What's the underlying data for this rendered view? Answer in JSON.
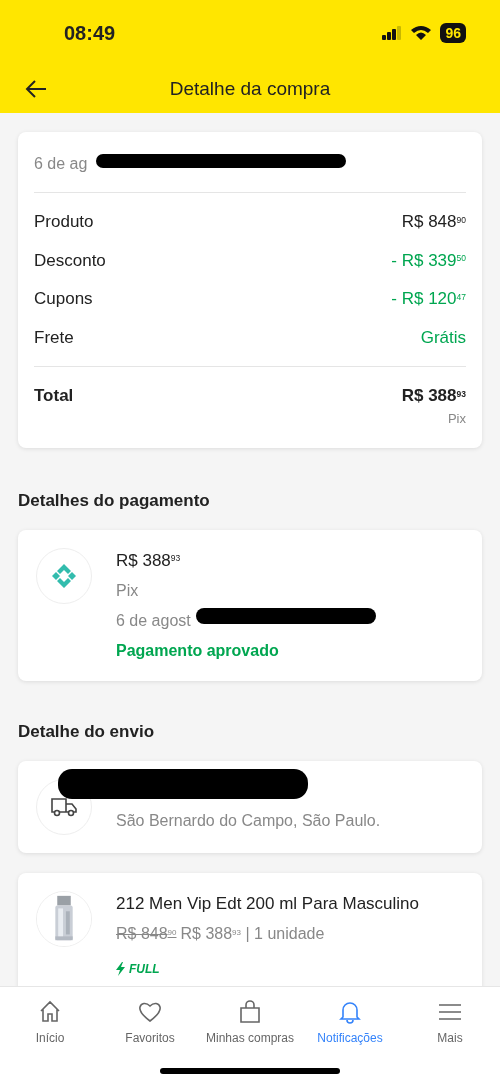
{
  "status_bar": {
    "time": "08:49",
    "battery": "96"
  },
  "header": {
    "title": "Detalhe da compra"
  },
  "summary": {
    "date": "6 de ag",
    "rows": [
      {
        "label": "Produto",
        "value": "R$ 848$^{90}$",
        "kind": "charge"
      },
      {
        "label": "Desconto",
        "value": "- R$ 339$^{50}$",
        "kind": "credit"
      },
      {
        "label": "Cupons",
        "value": "- R$ 120$^{47}$",
        "kind": "credit"
      },
      {
        "label": "Frete",
        "value": "Grátis",
        "kind": "credit"
      }
    ],
    "total": {
      "label": "Total",
      "value": "R$ 388$^{93}$",
      "method": "Pix"
    }
  },
  "payment": {
    "heading": "Detalhes do pagamento",
    "amount": "R$ 388$^{93}$",
    "method": "Pix",
    "date": "6 de agost",
    "status": "Pagamento aprovado"
  },
  "shipping": {
    "heading": "Detalhe do envio",
    "address": "São Bernardo do Campo, São Paulo."
  },
  "product": {
    "title": "212 Men Vip Edt 200 ml Para Masculino",
    "old_price": "R$ 848$^{90}$",
    "price": "R$ 388$^{93}$ | 1 unidade",
    "badge": "FULL"
  },
  "tab_bar": [
    {
      "label": "Início",
      "kind": "home",
      "selected": false
    },
    {
      "label": "Favoritos",
      "kind": "heart",
      "selected": false
    },
    {
      "label": "Minhas compras",
      "kind": "bag",
      "selected": false
    },
    {
      "label": "Notificações",
      "kind": "bell",
      "selected": true
    },
    {
      "label": "Mais",
      "kind": "menu",
      "selected": false
    }
  ]
}
